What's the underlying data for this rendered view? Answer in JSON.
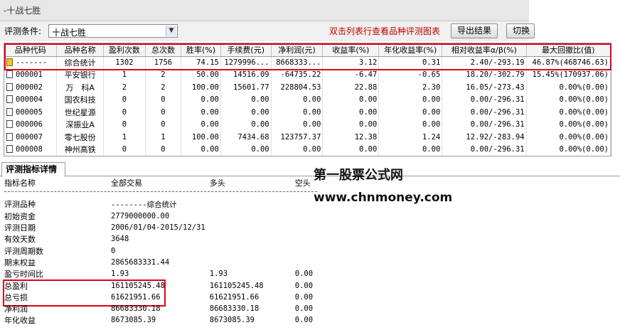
{
  "window": {
    "title": "-十战七胜"
  },
  "toolbar": {
    "condition_label": "评测条件:",
    "condition_value": "十战七胜",
    "hint": "双击列表行查看品种评测图表",
    "export_label": "导出结果",
    "switch_label": "切换"
  },
  "grid": {
    "headers": [
      "品种代码",
      "品种名称",
      "盈利次数",
      "总次数",
      "胜率(%)",
      "手续费(元)",
      "净利润(元)",
      "收益率(%)",
      "年化收益率(%)",
      "相对收益率α/β(%)",
      "最大回撤比(值)"
    ],
    "rows": [
      {
        "code": "-------",
        "name": "综合统计",
        "wins": "1302",
        "total": "1756",
        "rate": "74.15",
        "fee": "1279996...",
        "profit": "8668333...",
        "ret": "3.12",
        "annual": "0.31",
        "rel": "2.40/-293.19",
        "dd": "46.87%(468746.63)"
      },
      {
        "code": "000001",
        "name": "平安银行",
        "wins": "1",
        "total": "2",
        "rate": "50.00",
        "fee": "14516.09",
        "profit": "-64735.22",
        "ret": "-6.47",
        "annual": "-0.65",
        "rel": "18.20/-302.79",
        "dd": "15.45%(170937.06)"
      },
      {
        "code": "000002",
        "name": "万　科A",
        "wins": "2",
        "total": "2",
        "rate": "100.00",
        "fee": "15601.77",
        "profit": "228804.53",
        "ret": "22.88",
        "annual": "2.30",
        "rel": "16.05/-273.43",
        "dd": "0.00%(0.00)"
      },
      {
        "code": "000004",
        "name": "国农科技",
        "wins": "0",
        "total": "0",
        "rate": "0.00",
        "fee": "0.00",
        "profit": "0.00",
        "ret": "0.00",
        "annual": "0.00",
        "rel": "0.00/-296.31",
        "dd": "0.00%(0.00)"
      },
      {
        "code": "000005",
        "name": "世纪星源",
        "wins": "0",
        "total": "0",
        "rate": "0.00",
        "fee": "0.00",
        "profit": "0.00",
        "ret": "0.00",
        "annual": "0.00",
        "rel": "0.00/-296.31",
        "dd": "0.00%(0.00)"
      },
      {
        "code": "000006",
        "name": "深振业A",
        "wins": "0",
        "total": "0",
        "rate": "0.00",
        "fee": "0.00",
        "profit": "0.00",
        "ret": "0.00",
        "annual": "0.00",
        "rel": "0.00/-296.31",
        "dd": "0.00%(0.00)"
      },
      {
        "code": "000007",
        "name": "零七股份",
        "wins": "1",
        "total": "1",
        "rate": "100.00",
        "fee": "7434.68",
        "profit": "123757.37",
        "ret": "12.38",
        "annual": "1.24",
        "rel": "12.92/-283.94",
        "dd": "0.00%(0.00)"
      },
      {
        "code": "000008",
        "name": "神州高铁",
        "wins": "0",
        "total": "0",
        "rate": "0.00",
        "fee": "0.00",
        "profit": "0.00",
        "ret": "0.00",
        "annual": "0.00",
        "rel": "0.00/-296.31",
        "dd": "0.00%(0.00)"
      }
    ]
  },
  "tabs": {
    "detail_label": "评测指标详情"
  },
  "detail": {
    "headers": [
      "指标名称",
      "全部交易",
      "多头",
      "空头"
    ],
    "rows": [
      {
        "name": "评测品种",
        "all": "--------综合统计",
        "long": "",
        "short": ""
      },
      {
        "name": "初始资金",
        "all": "2779000000.00",
        "long": "",
        "short": ""
      },
      {
        "name": "评测日期",
        "all": "2006/01/04-2015/12/31",
        "long": "",
        "short": ""
      },
      {
        "name": "有效天数",
        "all": "3648",
        "long": "",
        "short": ""
      },
      {
        "name": "评测周期数",
        "all": "0",
        "long": "",
        "short": ""
      },
      {
        "name": "期末权益",
        "all": "2865683331.44",
        "long": "",
        "short": ""
      },
      {
        "name": "盈亏时间比",
        "all": "1.93",
        "long": "1.93",
        "short": "0.00"
      },
      {
        "name": "总盈利",
        "all": "161105245.48",
        "long": "161105245.48",
        "short": "0.00"
      },
      {
        "name": "总亏损",
        "all": "61621951.66",
        "long": "61621951.66",
        "short": "0.00"
      },
      {
        "name": "净利润",
        "all": "86683330.18",
        "long": "86683330.18",
        "short": "0.00"
      },
      {
        "name": "年化收益",
        "all": "8673085.39",
        "long": "8673085.39",
        "short": "0.00"
      }
    ]
  },
  "watermark": {
    "line1": "第一股票公式网",
    "line2": "www.chnmoney.com"
  },
  "colors": {
    "highlight": "#e0001b",
    "hint": "#c00000"
  }
}
